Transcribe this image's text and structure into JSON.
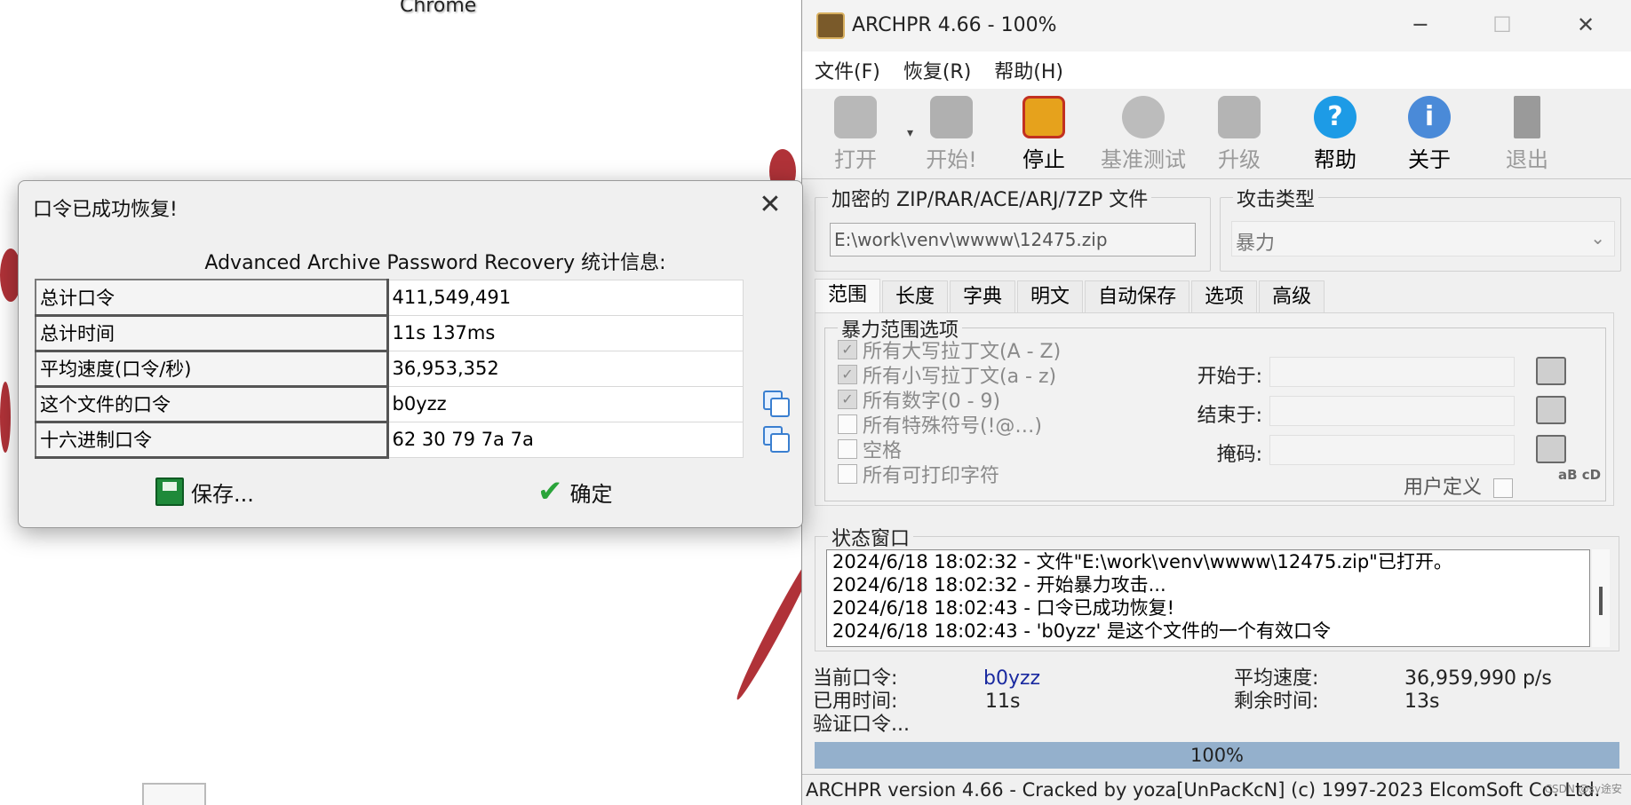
{
  "desktop": {
    "label": "Chrome"
  },
  "main_window": {
    "title": "ARCHPR 4.66 - 100%",
    "controls": {
      "minimize": "─",
      "maximize": "☐",
      "close": "✕"
    },
    "menu": [
      "文件(F)",
      "恢复(R)",
      "帮助(H)"
    ],
    "toolbar": [
      {
        "label": "打开",
        "icon": "open-folder-icon",
        "enabled": false
      },
      {
        "label": "开始!",
        "icon": "start-icon",
        "enabled": false
      },
      {
        "label": "停止",
        "icon": "stop-lock-icon",
        "enabled": true
      },
      {
        "label": "基准测试",
        "icon": "stopwatch-icon",
        "enabled": false
      },
      {
        "label": "升级",
        "icon": "upgrade-icon",
        "enabled": false
      },
      {
        "label": "帮助",
        "icon": "help-icon",
        "enabled": true
      },
      {
        "label": "关于",
        "icon": "info-icon",
        "enabled": true
      },
      {
        "label": "退出",
        "icon": "exit-door-icon",
        "enabled": false
      }
    ],
    "file_group": {
      "title": "加密的 ZIP/RAR/ACE/ARJ/7ZP 文件",
      "path": "E:\\work\\venv\\wwww\\12475.zip"
    },
    "attack_group": {
      "title": "攻击类型",
      "value": "暴力"
    },
    "tabs": [
      "范围",
      "长度",
      "字典",
      "明文",
      "自动保存",
      "选项",
      "高级"
    ],
    "brute_range": {
      "title": "暴力范围选项",
      "options": [
        {
          "label": "所有大写拉丁文(A - Z)",
          "checked": true
        },
        {
          "label": "所有小写拉丁文(a - z)",
          "checked": true
        },
        {
          "label": "所有数字(0 - 9)",
          "checked": true
        },
        {
          "label": "所有特殊符号(!@…)",
          "checked": false
        },
        {
          "label": "空格",
          "checked": false
        },
        {
          "label": "所有可打印字符",
          "checked": false
        }
      ],
      "start_label": "开始于:",
      "end_label": "结束于:",
      "mask_label": "掩码:",
      "user_defined_label": "用户定义",
      "abcd_icon": "aB cD"
    },
    "status": {
      "title": "状态窗口",
      "log": [
        "2024/6/18 18:02:32 - 文件\"E:\\work\\venv\\wwww\\12475.zip\"已打开。",
        "2024/6/18 18:02:32 - 开始暴力攻击...",
        "2024/6/18 18:02:43 - 口令已成功恢复!",
        "2024/6/18 18:02:43 - 'b0yzz' 是这个文件的一个有效口令"
      ]
    },
    "info": {
      "current_label": "当前口令:",
      "current_value": "b0yzz",
      "elapsed_label": "已用时间:",
      "elapsed_value": "11s",
      "verify_label": "验证口令...",
      "avg_label": "平均速度:",
      "avg_value": "36,959,990 p/s",
      "remain_label": "剩余时间:",
      "remain_value": "13s"
    },
    "progress": {
      "text": "100%",
      "value": 1.0
    },
    "statusbar": "ARCHPR version 4.66  - Cracked by yoza[UnPacKcN] (c) 1997-2023 ElcomSoft Co. Ltd.",
    "watermark": "CSDN @sy途安"
  },
  "dialog": {
    "title": "口令已成功恢复!",
    "close": "✕",
    "subtitle": "Advanced Archive Password Recovery 统计信息:",
    "rows": [
      {
        "key": "总计口令",
        "value": "411,549,491"
      },
      {
        "key": "总计时间",
        "value": "11s 137ms"
      },
      {
        "key": "平均速度(口令/秒)",
        "value": "36,953,352"
      },
      {
        "key": "这个文件的口令",
        "value": "b0yzz"
      },
      {
        "key": "十六进制口令",
        "value": "62 30 79 7a 7a"
      }
    ],
    "save_label": "保存...",
    "ok_label": "确定"
  },
  "colors": {
    "accent_blue": "#1a2aa0",
    "progress": "#94b0cc",
    "ok_green": "#2aa43a"
  }
}
